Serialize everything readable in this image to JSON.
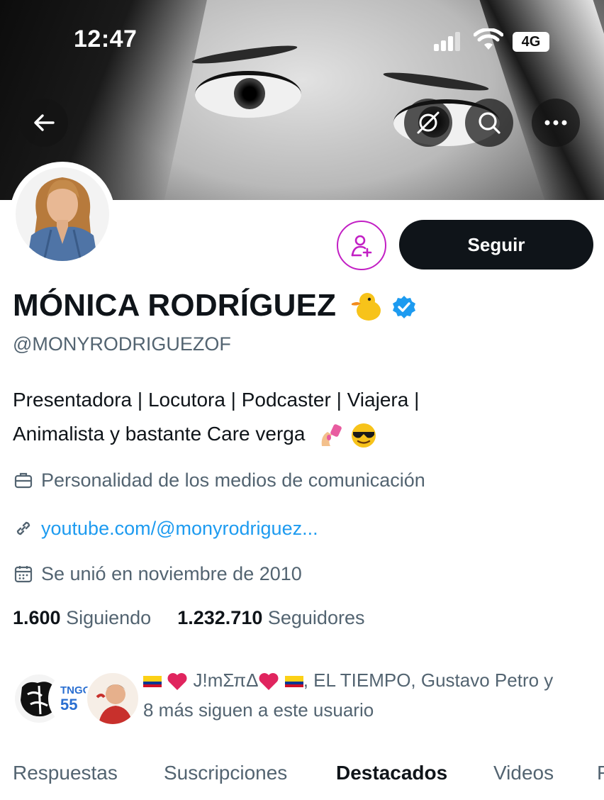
{
  "status_bar": {
    "time": "12:47",
    "network": "4G"
  },
  "banner": {
    "back_button": "back-arrow-icon",
    "actions": [
      "mute-icon",
      "search-icon",
      "more-icon"
    ]
  },
  "profile": {
    "display_name": "MÓNICA RODRÍGUEZ",
    "name_emoji": "duck-emoji",
    "verified": true,
    "handle": "@MONYRODRIGUEZOF",
    "bio_line1": "Presentadora | Locutora | Podcaster | Viajera |",
    "bio_line2": "Animalista y bastante Care verga",
    "category": "Personalidad de los medios de comunicación",
    "website": "youtube.com/@monyrodriguez...",
    "joined": "Se unió en noviembre de 2010",
    "following_count": "1.600",
    "following_label": "Siguiendo",
    "followers_count": "1.232.710",
    "followers_label": "Seguidores"
  },
  "buttons": {
    "follow": "Seguir",
    "subscribe_icon": "person-add-icon"
  },
  "followed_by": {
    "line1_name": "J!mΣπΔ",
    "line1_rest": ", EL TIEMPO, Gustavo Petro y",
    "line2": "8 más siguen a este usuario",
    "avatar2_text1": "TNGO",
    "avatar2_text2": "55"
  },
  "tabs": [
    {
      "label": "Respuestas"
    },
    {
      "label": "Suscripciones"
    },
    {
      "label": "Destacados"
    },
    {
      "label": "Videos"
    },
    {
      "label": "F"
    }
  ],
  "colors": {
    "accent_blue": "#1d9bf0",
    "subscribe_magenta": "#c21fc4",
    "secondary_text": "#536471",
    "primary_text": "#0f1419"
  }
}
